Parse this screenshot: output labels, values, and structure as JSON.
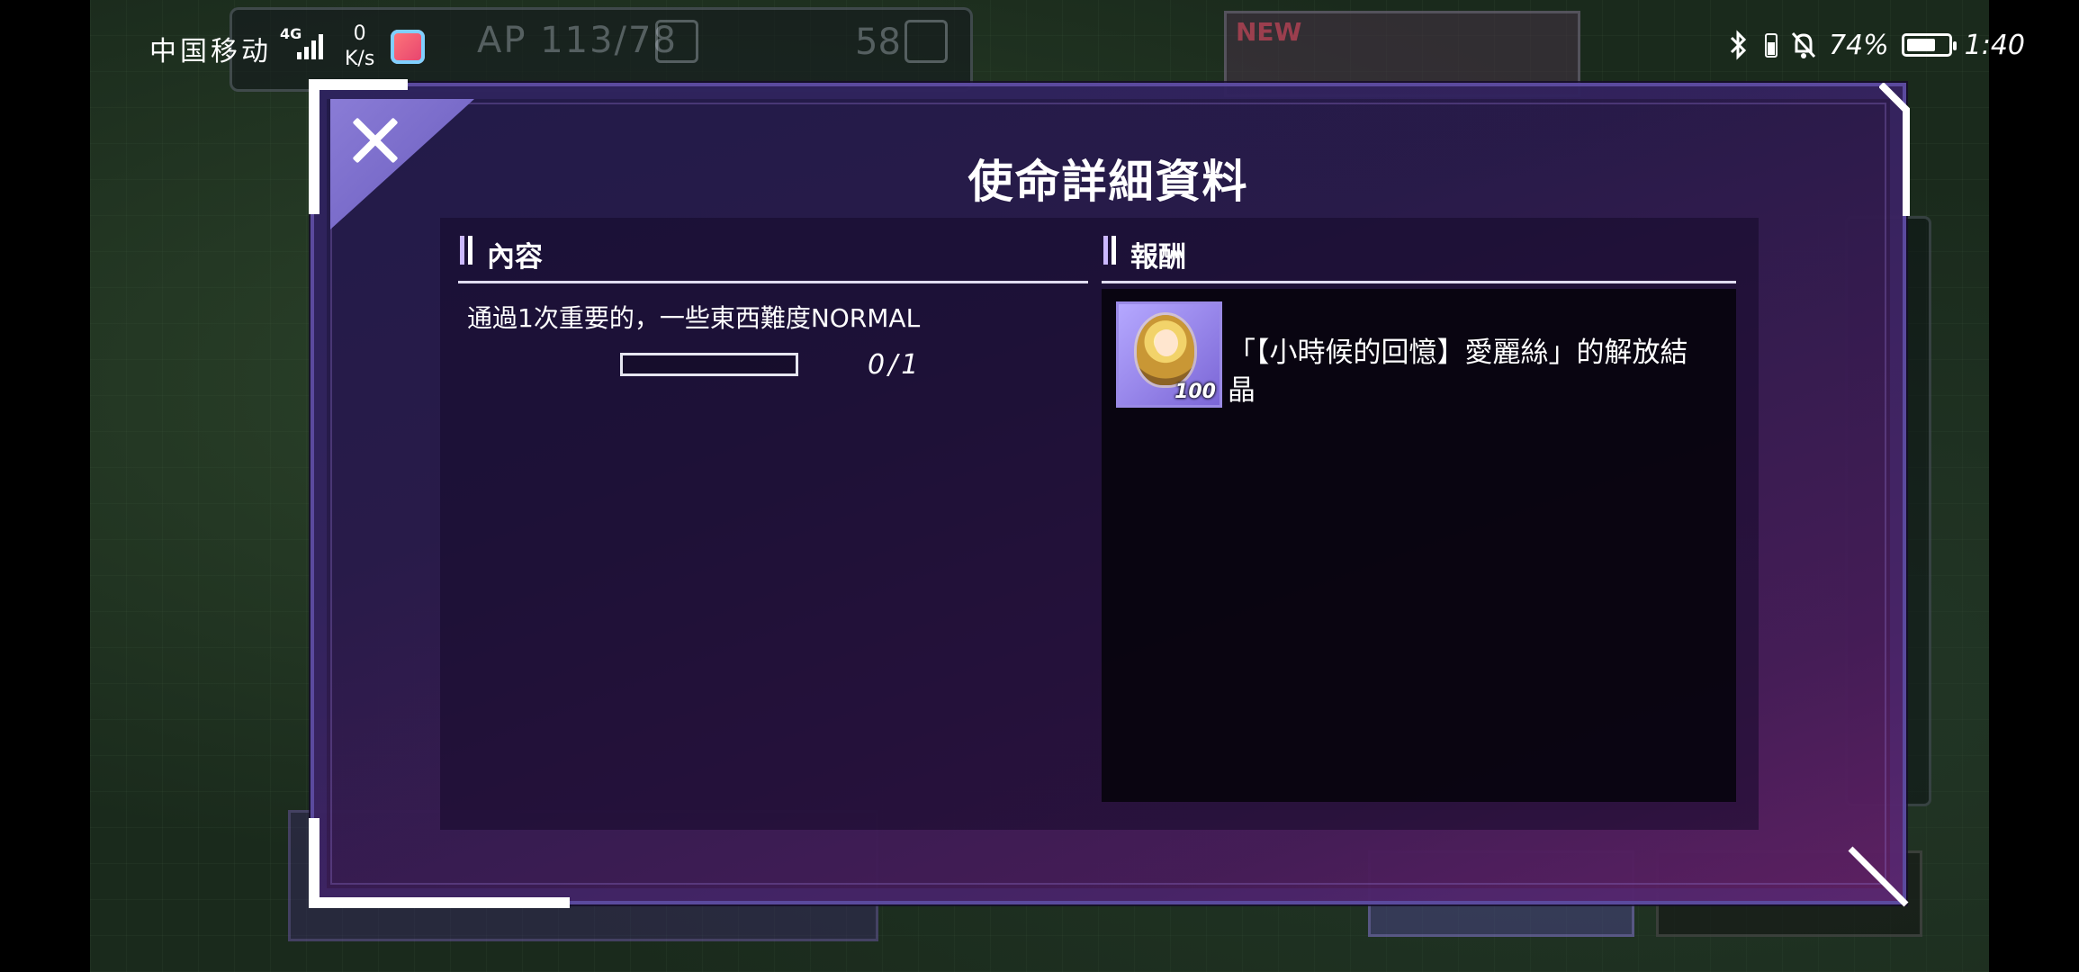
{
  "status_bar": {
    "carrier": "中国移动",
    "network": "4G",
    "speed_value": "0",
    "speed_unit": "K/s",
    "battery_percent": "74%",
    "battery_level": 0.74,
    "time": "1:40"
  },
  "background": {
    "ap_label": "AP 113/78",
    "gem_count": "58",
    "new_badge": "NEW"
  },
  "dialog": {
    "title": "使命詳細資料",
    "content_section": {
      "title": "內容",
      "mission_text": "通過1次重要的，一些東西難度NORMAL",
      "progress_current": 0,
      "progress_total": 1,
      "progress_text": "0/1"
    },
    "reward_section": {
      "title": "報酬",
      "items": [
        {
          "name": "「【小時候的回憶】愛麗絲」的解放結晶",
          "quantity": "100",
          "icon": "liberation-crystal-icon"
        }
      ]
    }
  },
  "colors": {
    "dialog_bg_start": "#221a4a",
    "dialog_bg_end": "#5f2064",
    "accent": "#a88cff",
    "close_tab": "#8a7cd6"
  }
}
